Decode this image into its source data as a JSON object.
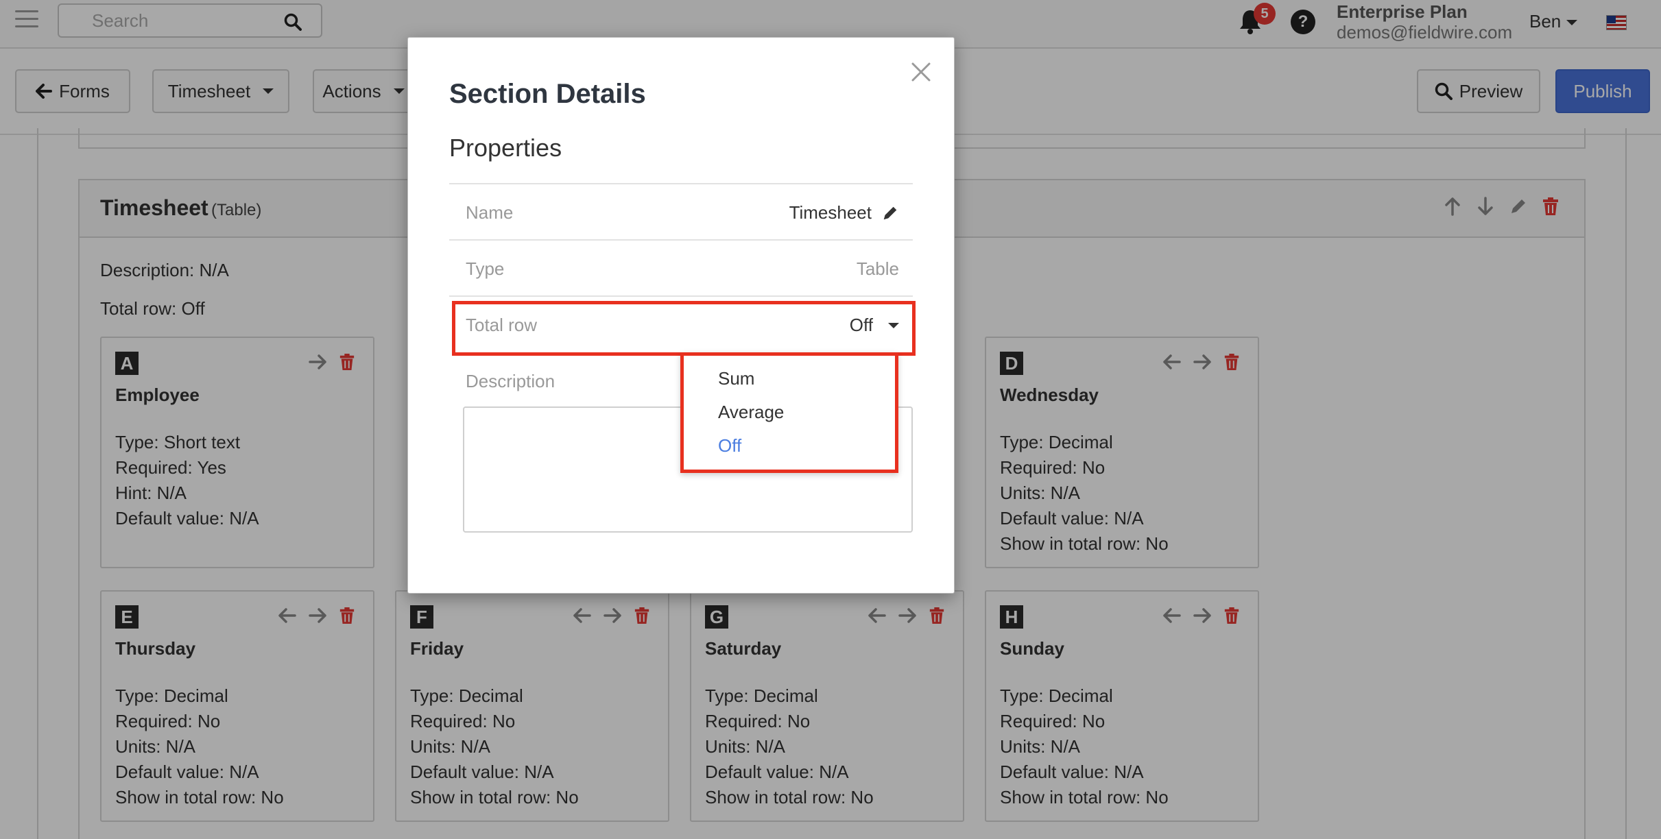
{
  "topnav": {
    "search_placeholder": "Search",
    "notification_count": "5",
    "help_label": "?",
    "plan": "Enterprise Plan",
    "email": "demos@fieldwire.com",
    "user": "Ben"
  },
  "toolbar": {
    "forms_label": "Forms",
    "timesheet_label": "Timesheet",
    "actions_label": "Actions",
    "preview_label": "Preview",
    "publish_label": "Publish"
  },
  "section": {
    "title": "Timesheet",
    "kind": "(Table)",
    "description": "Description: N/A",
    "total_row": "Total row: Off"
  },
  "columns": [
    {
      "letter": "A",
      "name": "Employee",
      "props": [
        "Type: Short text",
        "Required: Yes",
        "Hint: N/A",
        "Default value: N/A"
      ]
    },
    {
      "letter": "D",
      "name": "Wednesday",
      "props": [
        "Type: Decimal",
        "Required: No",
        "Units: N/A",
        "Default value: N/A",
        "Show in total row: No"
      ]
    },
    {
      "letter": "E",
      "name": "Thursday",
      "props": [
        "Type: Decimal",
        "Required: No",
        "Units: N/A",
        "Default value: N/A",
        "Show in total row: No"
      ]
    },
    {
      "letter": "F",
      "name": "Friday",
      "props": [
        "Type: Decimal",
        "Required: No",
        "Units: N/A",
        "Default value: N/A",
        "Show in total row: No"
      ]
    },
    {
      "letter": "G",
      "name": "Saturday",
      "props": [
        "Type: Decimal",
        "Required: No",
        "Units: N/A",
        "Default value: N/A",
        "Show in total row: No"
      ]
    },
    {
      "letter": "H",
      "name": "Sunday",
      "props": [
        "Type: Decimal",
        "Required: No",
        "Units: N/A",
        "Default value: N/A",
        "Show in total row: No"
      ]
    }
  ],
  "modal": {
    "title": "Section Details",
    "subtitle": "Properties",
    "name_label": "Name",
    "name_value": "Timesheet",
    "type_label": "Type",
    "type_value": "Table",
    "total_label": "Total row",
    "total_value": "Off",
    "description_label": "Description",
    "description_value": ""
  },
  "dropdown": {
    "options": [
      "Sum",
      "Average",
      "Off"
    ],
    "selected": "Off",
    "selected_color": "#4a7de0"
  },
  "colors": {
    "accent": "#4a73d9",
    "highlight": "#e8301f",
    "danger": "#e53935"
  }
}
